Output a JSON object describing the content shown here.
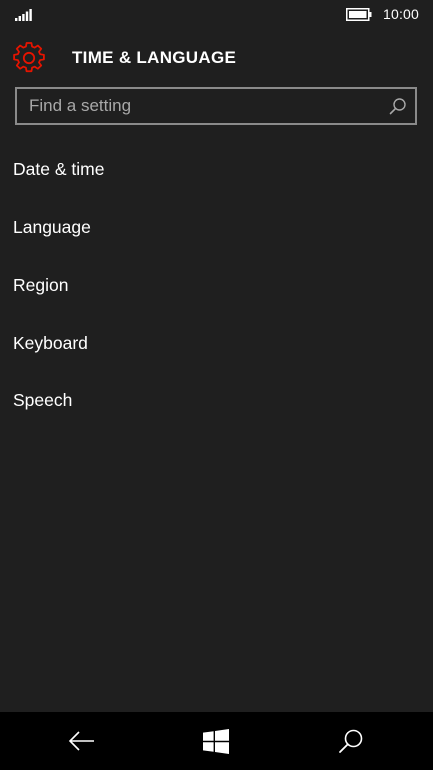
{
  "status_bar": {
    "time": "10:00",
    "signal_icon": "signal-strength-icon",
    "battery_icon": "battery-icon"
  },
  "header": {
    "title": "TIME & LANGUAGE",
    "icon": "gear-icon",
    "accent_color": "#e51400"
  },
  "search": {
    "placeholder": "Find a setting",
    "value": "",
    "icon": "search-icon"
  },
  "settings": {
    "items": [
      {
        "label": "Date & time"
      },
      {
        "label": "Language"
      },
      {
        "label": "Region"
      },
      {
        "label": "Keyboard"
      },
      {
        "label": "Speech"
      }
    ]
  },
  "nav_bar": {
    "back_icon": "back-arrow-icon",
    "start_icon": "windows-logo-icon",
    "search_icon": "search-icon"
  },
  "colors": {
    "background": "#1f1f1f",
    "nav_background": "#000000",
    "search_border": "#8a8a8a",
    "text": "#ffffff"
  }
}
